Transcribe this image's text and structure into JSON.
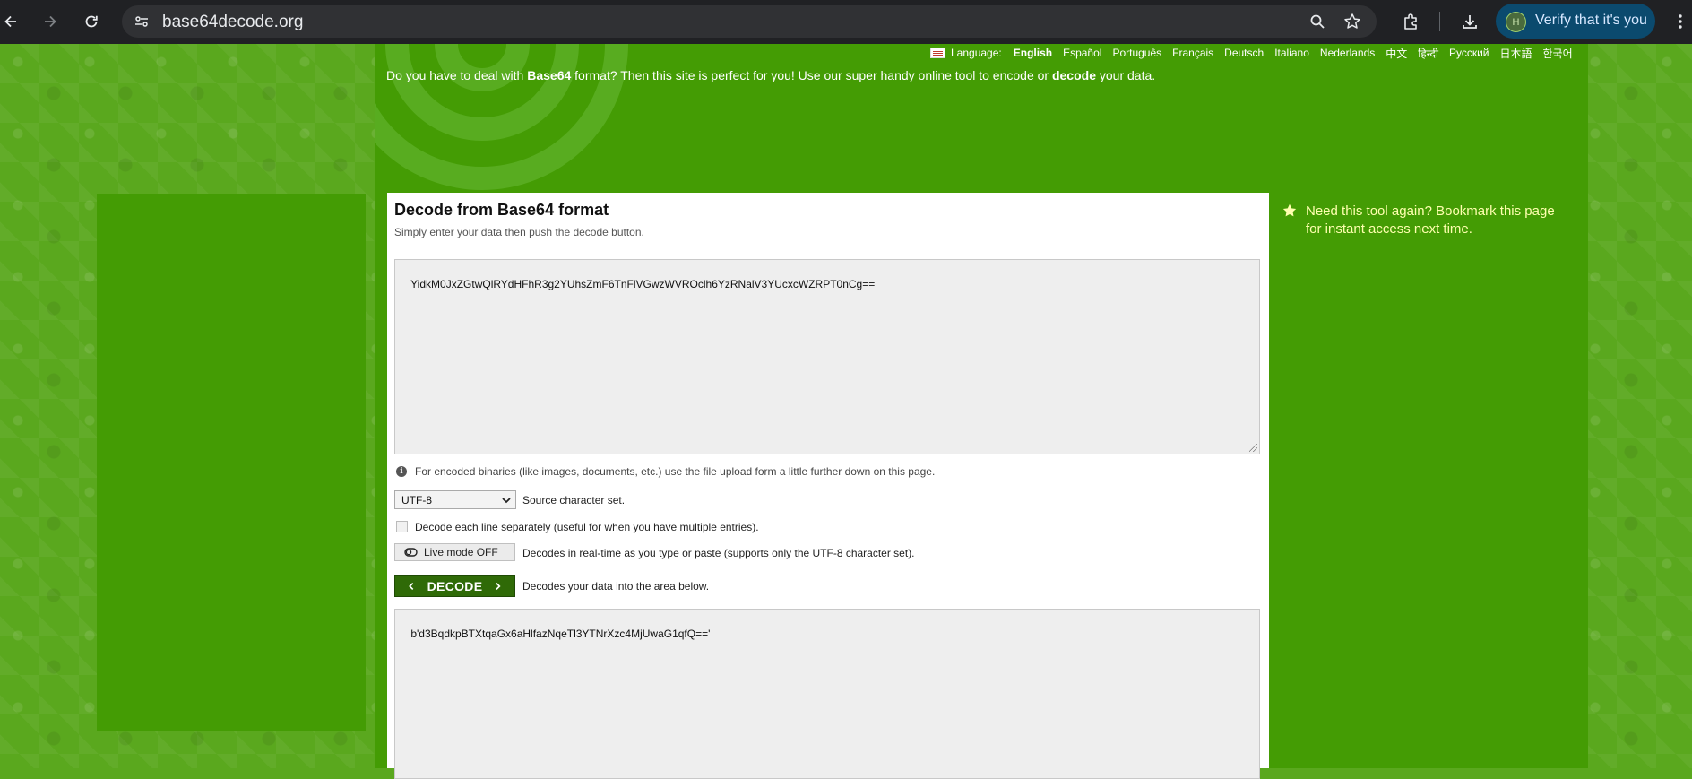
{
  "browser": {
    "url": "base64decode.org",
    "verify_label": "Verify that it's you",
    "avatar_initial": "H"
  },
  "language_bar": {
    "label": "Language:",
    "items": [
      "English",
      "Español",
      "Português",
      "Français",
      "Deutsch",
      "Italiano",
      "Nederlands",
      "中文",
      "हिन्दी",
      "Русский",
      "日本語",
      "한국어"
    ],
    "active": "English"
  },
  "intro": {
    "part1": "Do you have to deal with ",
    "bold1": "Base64",
    "part2": " format? Then this site is perfect for you! Use our super handy online tool to encode or ",
    "bold2": "decode",
    "part3": " your data."
  },
  "tool": {
    "title": "Decode from Base64 format",
    "subtitle": "Simply enter your data then push the decode button.",
    "input_value": "YidkM0JxZGtwQlRYdHFhR3g2YUhsZmF6TnFlVGwzWVROclh6YzRNalV3YUcxcWZRPT0nCg==",
    "binary_note": "For encoded binaries (like images, documents, etc.) use the file upload form a little further down on this page.",
    "charset_value": "UTF-8",
    "charset_label": "Source character set.",
    "separate_lines_label": "Decode each line separately (useful for when you have multiple entries).",
    "live_mode_label": "Live mode OFF",
    "live_mode_desc": "Decodes in real-time as you type or paste (supports only the UTF-8 character set).",
    "decode_label": "DECODE",
    "decode_desc": "Decodes your data into the area below.",
    "output_value": "b'd3BqdkpBTXtqaGx6aHlfazNqeTl3YTNrXzc4MjUwaG1qfQ=='"
  },
  "sidebar": {
    "bookmark_tip": "Need this tool again? Bookmark this page for instant access next time."
  },
  "colors": {
    "page_green": "#449c04",
    "pattern_green": "#5aa81e",
    "button_green": "#2f6a07",
    "tip_yellow": "#ffffb0"
  }
}
